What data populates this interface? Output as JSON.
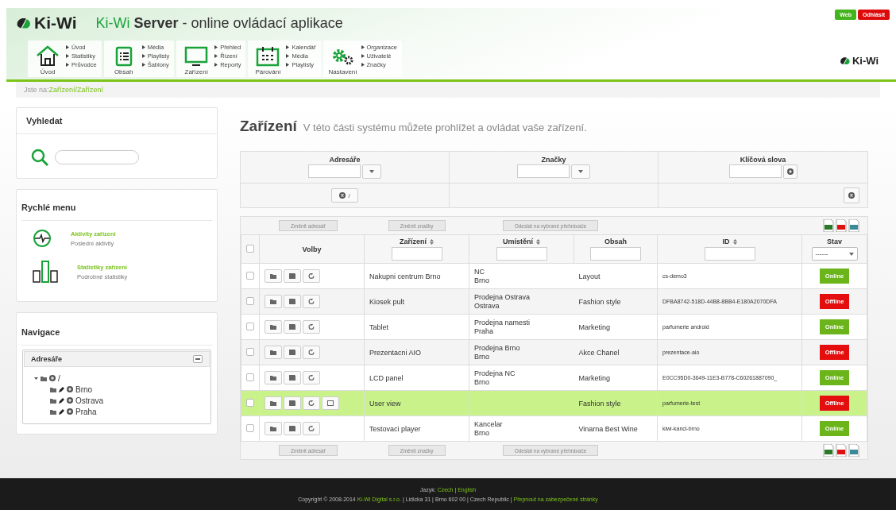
{
  "header": {
    "logo": "Ki-Wi",
    "brand": "Ki-Wi",
    "product": "Server",
    "tagline": "- online ovládací aplikace",
    "corner_logo": "Ki-Wi",
    "top_buttons": [
      {
        "label": "Web",
        "color": "#44b41c"
      },
      {
        "label": "Odhlásit",
        "color": "#dd0a0a"
      }
    ],
    "nav": [
      {
        "label": "Úvod",
        "kind": "home",
        "links": [
          "Úvod",
          "Statistiky",
          "Průvodce"
        ]
      },
      {
        "label": "Obsah",
        "kind": "list",
        "links": [
          "Média",
          "Playlisty",
          "Šablony"
        ]
      },
      {
        "label": "Zařízení",
        "kind": "monitor",
        "links": [
          "Přehled",
          "Řízení",
          "Reporty"
        ]
      },
      {
        "label": "Párování",
        "kind": "calendar",
        "links": [
          "Kalendář",
          "Média",
          "Playlisty"
        ]
      },
      {
        "label": "Nastavení",
        "kind": "gears",
        "links": [
          "Organizace",
          "Uživatelé",
          "Značky"
        ]
      }
    ]
  },
  "breadcrumb": {
    "prefix": "Jste na:",
    "path": "Zařízení/Zařízení"
  },
  "sidebar": {
    "search": {
      "title": "Vyhledat"
    },
    "quick_menu": {
      "title": "Rychlé menu",
      "items": [
        {
          "kind": "pulse",
          "title": "Aktivity zařízení",
          "subtitle": "Poslední aktivity"
        },
        {
          "kind": "bars",
          "title": "Statistiky zařízení",
          "subtitle": "Podrobné statistiky"
        }
      ]
    },
    "navigation": {
      "title": "Navigace",
      "panel": "Adresáře",
      "tree": [
        {
          "label": "/",
          "expanded": true,
          "children": [
            {
              "label": "Brno"
            },
            {
              "label": "Ostrava"
            },
            {
              "label": "Praha"
            }
          ]
        }
      ]
    }
  },
  "page": {
    "title": "Zařízení",
    "subtitle": "V této části systému můžete prohlížet a ovládat vaše zařízení."
  },
  "filters": {
    "columns": [
      "Adresáře",
      "Značky",
      "Klíčová slova"
    ],
    "directory_chip": "/"
  },
  "toolbar_top": [
    "Změnit adresář",
    "Změnit značky",
    "Odeslat na vybrané přehrávače"
  ],
  "toolbar_bottom": [
    "Změnit adresář",
    "Změnit značky",
    "Odeslat na vybrané přehrávače"
  ],
  "table": {
    "all_checked": false,
    "columns": [
      "Volby",
      "Zařízení",
      "Umístění",
      "Obsah",
      "ID",
      "Stav"
    ],
    "status_filter": "------",
    "rows": [
      {
        "checked": false,
        "selected": false,
        "extra_action": false,
        "device": "Nakupni centrum Brno",
        "location": [
          "NC",
          "Brno"
        ],
        "content": "Layout",
        "id": "cs-demo3",
        "status": "Online",
        "online": true
      },
      {
        "checked": false,
        "selected": false,
        "extra_action": false,
        "device": "Kiosek pult",
        "location": [
          "Prodejna Ostrava",
          "Ostrava"
        ],
        "content": "Fashion style",
        "id": "DFBA8742-518D-44B8-8BB4-E180A2070DFA",
        "status": "Offline",
        "online": false
      },
      {
        "checked": false,
        "selected": false,
        "extra_action": false,
        "device": "Tablet",
        "location": [
          "Prodejna namesti",
          "Praha"
        ],
        "content": "Marketing",
        "id": "parfumerie android",
        "status": "Online",
        "online": true
      },
      {
        "checked": false,
        "selected": false,
        "extra_action": false,
        "device": "Prezentacni AIO",
        "location": [
          "Prodejna Brno",
          "Brno"
        ],
        "content": "Akce Chanel",
        "id": "prezentace-aio",
        "status": "Offline",
        "online": false
      },
      {
        "checked": false,
        "selected": false,
        "extra_action": false,
        "device": "LCD panel",
        "location": [
          "Prodejna NC",
          "Brno"
        ],
        "content": "Marketing",
        "id": "E0CC95D0-3649-11E3-B778-C60261887090_",
        "status": "Online",
        "online": true
      },
      {
        "checked": false,
        "selected": true,
        "extra_action": true,
        "device": "User view",
        "location": [],
        "content": "Fashion style",
        "id": "parfumerie-test",
        "status": "Offline",
        "online": false
      },
      {
        "checked": false,
        "selected": false,
        "extra_action": false,
        "device": "Testovaci player",
        "location": [
          "Kancelar",
          "Brno"
        ],
        "content": "Vinarna Best Wine",
        "id": "kiwi-kancl-brno",
        "status": "Online",
        "online": true
      }
    ]
  },
  "footer": {
    "language_label": "Jazyk:",
    "languages": [
      "Czech",
      "English"
    ],
    "language_separator": "|",
    "copyright": "Copyright © 2008-2014",
    "company": "Ki-Wi Digital s.r.o.",
    "address": "| Lidicka 31 | Brno 602 00 | Czech Republic |",
    "secure_link": "Přepnout na zabezpečené stránky"
  }
}
